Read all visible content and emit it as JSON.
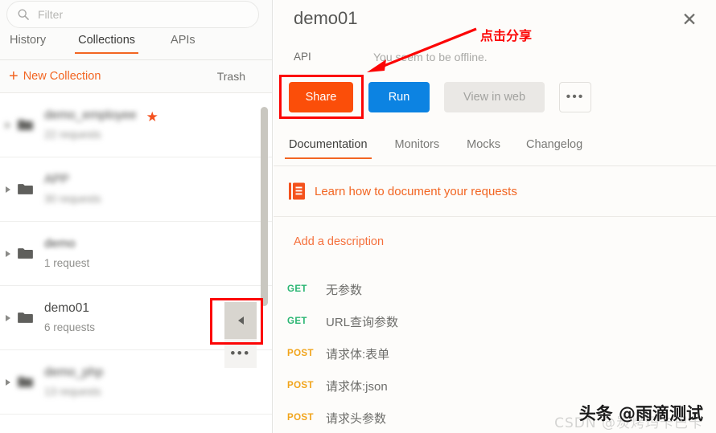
{
  "sidebar": {
    "filter": {
      "placeholder": "Filter",
      "value": "",
      "icon": "search-icon"
    },
    "tabs": [
      {
        "label": "History",
        "active": false
      },
      {
        "label": "Collections",
        "active": true
      },
      {
        "label": "APIs",
        "active": false
      }
    ],
    "new_collection_label": "New Collection",
    "new_collection_plus": "+",
    "trash_label": "Trash",
    "collections": [
      {
        "name": "demo_employee",
        "sub": "22 requests",
        "starred": true,
        "blurred": true
      },
      {
        "name": "APP",
        "sub": "30 requests",
        "starred": false,
        "blurred": true
      },
      {
        "name": "demo",
        "sub": "1 request",
        "starred": false,
        "blurred": false
      },
      {
        "name": "demo01",
        "sub": "6 requests",
        "starred": false,
        "blurred": false
      },
      {
        "name": "demo_php",
        "sub": "13 requests",
        "starred": false,
        "blurred": true
      }
    ],
    "collapse_label": "◀",
    "more_label": "•••"
  },
  "panel": {
    "title": "demo01",
    "close_label": "✕",
    "api_label": "API",
    "offline_text": "You seem to be offline.",
    "buttons": {
      "share": "Share",
      "run": "Run",
      "view_in_web": "View in web",
      "more": "•••"
    },
    "tabs": [
      {
        "label": "Documentation",
        "active": true
      },
      {
        "label": "Monitors",
        "active": false
      },
      {
        "label": "Mocks",
        "active": false
      },
      {
        "label": "Changelog",
        "active": false
      }
    ],
    "learn_link": "Learn how to document your requests",
    "add_description": "Add a description",
    "requests": [
      {
        "method": "GET",
        "name": "无参数"
      },
      {
        "method": "GET",
        "name": "URL查询参数"
      },
      {
        "method": "POST",
        "name": "请求体:表单"
      },
      {
        "method": "POST",
        "name": "请求体:json"
      },
      {
        "method": "POST",
        "name": "请求头参数"
      }
    ]
  },
  "annotations": {
    "arrow_label": "点击分享",
    "highlight_color": "#fc0505"
  },
  "watermark": {
    "main": "头条 @雨滴测试",
    "sub": "CSDN @炭烤玛卡巴卡"
  },
  "colors": {
    "accent_orange": "#f26522",
    "share_orange": "#fb4e09",
    "run_blue": "#0c83e2",
    "get_green": "#2bb673",
    "post_yellow": "#f1a41a"
  }
}
